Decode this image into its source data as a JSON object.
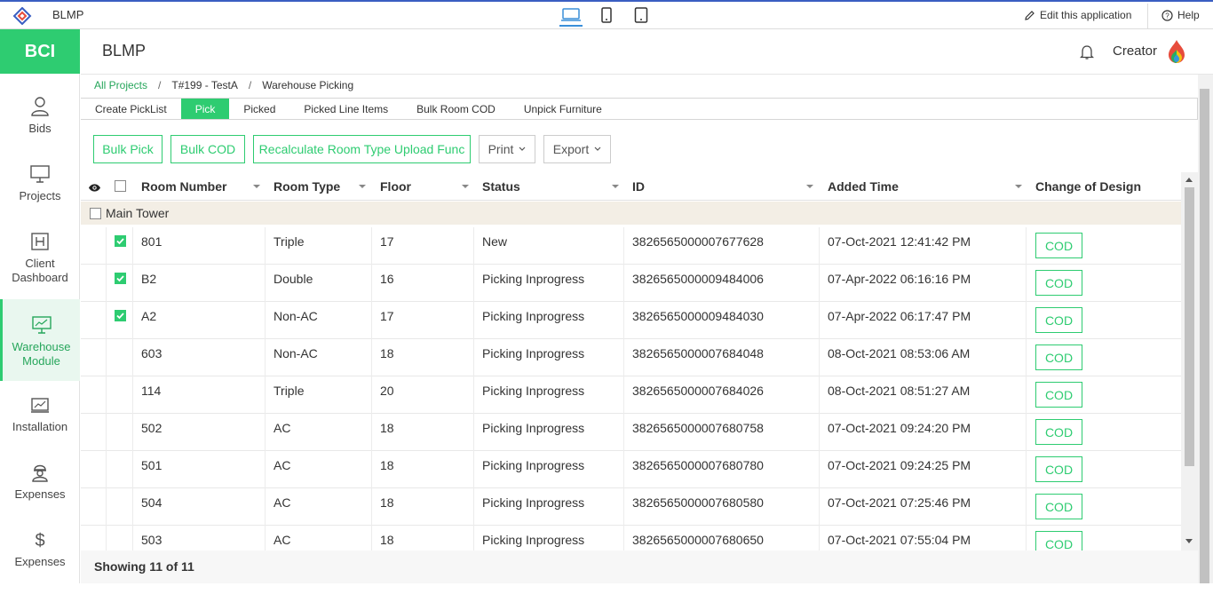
{
  "topbar": {
    "app_name": "BLMP",
    "edit_label": "Edit this application",
    "help_label": "Help"
  },
  "sidebar": {
    "brand": "BCI",
    "items": [
      {
        "label": "Bids",
        "icon": "user-icon",
        "active": false
      },
      {
        "label": "Projects",
        "icon": "monitor-icon",
        "active": false
      },
      {
        "label": "Client Dashboard",
        "icon": "hospital-icon",
        "active": false
      },
      {
        "label": "Warehouse Module",
        "icon": "monitor-icon",
        "active": true
      },
      {
        "label": "Installation",
        "icon": "chart-icon",
        "active": false
      },
      {
        "label": "Expenses",
        "icon": "worker-icon",
        "active": false
      },
      {
        "label": "Expenses",
        "icon": "dollar-icon",
        "active": false
      }
    ]
  },
  "header": {
    "title": "BLMP",
    "user": "Creator"
  },
  "breadcrumb": [
    "All Projects",
    "T#199 - TestA",
    "Warehouse Picking"
  ],
  "tabs": [
    "Create PickList",
    "Pick",
    "Picked",
    "Picked Line Items",
    "Bulk Room COD",
    "Unpick Furniture"
  ],
  "active_tab": "Pick",
  "toolbar": {
    "bulk_pick": "Bulk Pick",
    "bulk_cod": "Bulk COD",
    "recalculate": "Recalculate Room Type Upload Func",
    "print": "Print",
    "export": "Export"
  },
  "table": {
    "columns": [
      "Room Number",
      "Room Type",
      "Floor",
      "Status",
      "ID",
      "Added Time",
      "Change of Design"
    ],
    "group": "Main Tower",
    "rows": [
      {
        "checked": true,
        "room": "801",
        "type": "Triple",
        "floor": "17",
        "status": "New",
        "id": "3826565000007677628",
        "added": "07-Oct-2021 12:41:42 PM",
        "cod": "COD"
      },
      {
        "checked": true,
        "room": "B2",
        "type": "Double",
        "floor": "16",
        "status": "Picking Inprogress",
        "id": "3826565000009484006",
        "added": "07-Apr-2022 06:16:16 PM",
        "cod": "COD"
      },
      {
        "checked": true,
        "room": "A2",
        "type": "Non-AC",
        "floor": "17",
        "status": "Picking Inprogress",
        "id": "3826565000009484030",
        "added": "07-Apr-2022 06:17:47 PM",
        "cod": "COD"
      },
      {
        "checked": false,
        "room": "603",
        "type": "Non-AC",
        "floor": "18",
        "status": "Picking Inprogress",
        "id": "3826565000007684048",
        "added": "08-Oct-2021 08:53:06 AM",
        "cod": "COD"
      },
      {
        "checked": false,
        "room": "114",
        "type": "Triple",
        "floor": "20",
        "status": "Picking Inprogress",
        "id": "3826565000007684026",
        "added": "08-Oct-2021 08:51:27 AM",
        "cod": "COD"
      },
      {
        "checked": false,
        "room": "502",
        "type": "AC",
        "floor": "18",
        "status": "Picking Inprogress",
        "id": "3826565000007680758",
        "added": "07-Oct-2021 09:24:20 PM",
        "cod": "COD"
      },
      {
        "checked": false,
        "room": "501",
        "type": "AC",
        "floor": "18",
        "status": "Picking Inprogress",
        "id": "3826565000007680780",
        "added": "07-Oct-2021 09:24:25 PM",
        "cod": "COD"
      },
      {
        "checked": false,
        "room": "504",
        "type": "AC",
        "floor": "18",
        "status": "Picking Inprogress",
        "id": "3826565000007680580",
        "added": "07-Oct-2021 07:25:46 PM",
        "cod": "COD"
      },
      {
        "checked": false,
        "room": "503",
        "type": "AC",
        "floor": "18",
        "status": "Picking Inprogress",
        "id": "3826565000007680650",
        "added": "07-Oct-2021 07:55:04 PM",
        "cod": "COD"
      }
    ]
  },
  "footer": {
    "showing": "Showing 11 of 11"
  },
  "colors": {
    "accent": "#2ecc71",
    "accent_dark": "#26a65b",
    "group_bg": "#f3eee5",
    "topstripe": "#3a5ec2"
  }
}
